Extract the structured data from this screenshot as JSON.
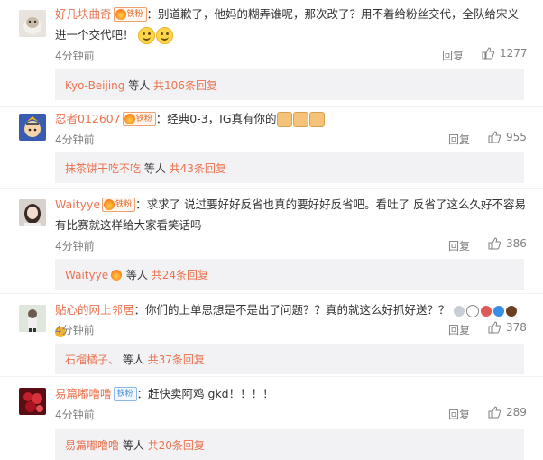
{
  "comments": [
    {
      "username": "好几块曲奇",
      "badge": "铁粉",
      "text": "：别道歉了，他妈的糊弄谁呢，那次改了？用不着给粉丝交代，全队给宋义进一个交代吧！",
      "time": "4分钟前",
      "reply_label": "回复",
      "likes": "1277",
      "sub": {
        "name": "Kyo-Beijing",
        "sep": " 等人 ",
        "more": "共106条回复"
      }
    },
    {
      "username": "忍者012607",
      "badge": "铁粉",
      "text": "：经典0-3，IG真有你的",
      "time": "4分钟前",
      "reply_label": "回复",
      "likes": "955",
      "sub": {
        "name": "抹茶饼干吃不吃",
        "sep": " 等人 ",
        "more": "共43条回复"
      }
    },
    {
      "username": "Waityye",
      "badge": "铁粉",
      "text": "：求求了 说过要好好反省也真的要好好反省吧。看吐了 反省了这么久好不容易有比赛就这样给大家看笑话吗",
      "time": "4分钟前",
      "reply_label": "回复",
      "likes": "386",
      "sub": {
        "name": "Waityye",
        "sep": " 等人 ",
        "more": "共24条回复"
      }
    },
    {
      "username": "贴心的网上邻居",
      "badge": "",
      "text": "：你们的上单思想是不是出了问题？？真的就这么好抓好送？？",
      "time": "4分钟前",
      "reply_label": "回复",
      "likes": "378",
      "sub": {
        "name": "石榴橘子、",
        "sep": " 等人 ",
        "more": "共37条回复"
      }
    },
    {
      "username": "易篇嘟噜噜",
      "badge": "铁粉",
      "text": "：赶快卖阿鸡 gkd！！！！",
      "time": "4分钟前",
      "reply_label": "回复",
      "likes": "289",
      "sub": {
        "name": "易篇嘟噜噜",
        "sep": " 等人 ",
        "more": "共20条回复"
      }
    }
  ]
}
